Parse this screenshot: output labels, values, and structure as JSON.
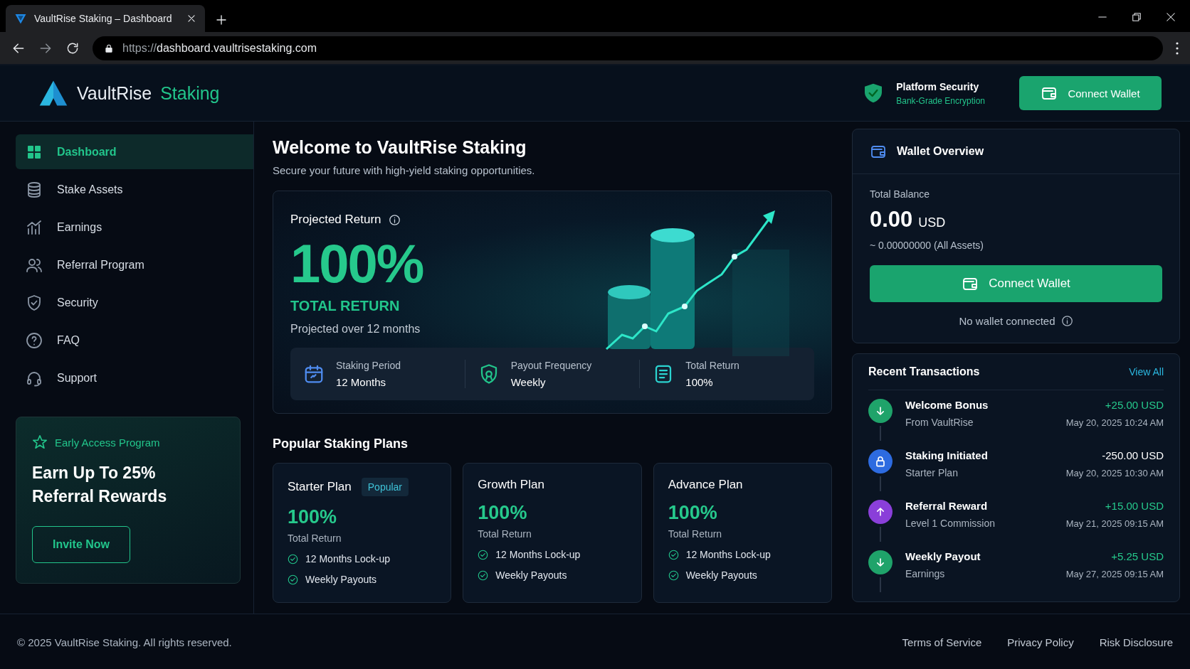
{
  "browser": {
    "tab_title": "VaultRise Staking – Dashboard",
    "url_scheme": "https://",
    "url_host": "dashboard.vaultrisestaking.com"
  },
  "header": {
    "brand": "VaultRise",
    "brand_accent": "Staking",
    "security_title": "Platform Security",
    "security_subtitle": "Bank-Grade Encryption",
    "connect_button": "Connect Wallet"
  },
  "sidebar": {
    "items": [
      {
        "label": "Dashboard",
        "kind": "grid",
        "selected": true
      },
      {
        "label": "Stake Assets",
        "kind": "coins",
        "selected": false
      },
      {
        "label": "Earnings",
        "kind": "chart",
        "selected": false
      },
      {
        "label": "Referral Program",
        "kind": "people",
        "selected": false
      },
      {
        "label": "Security",
        "kind": "shield",
        "selected": false
      },
      {
        "label": "FAQ",
        "kind": "question",
        "selected": false
      },
      {
        "label": "Support",
        "kind": "headset",
        "selected": false
      }
    ],
    "promo": {
      "label": "Early Access Program",
      "title": "Earn Up To 25% Referral Rewards",
      "button": "Invite Now"
    }
  },
  "main": {
    "title": "Welcome to VaultRise Staking",
    "subtitle": "Secure your future with high-yield staking opportunities.",
    "hero": {
      "label": "Projected Return",
      "value": "100%",
      "value_label": "TOTAL RETURN",
      "note": "Projected over 12 months",
      "stats": [
        {
          "kind": "calendar",
          "label": "Staking Period",
          "value": "12 Months"
        },
        {
          "kind": "badge",
          "label": "Payout Frequency",
          "value": "Weekly"
        },
        {
          "kind": "document",
          "label": "Total Return",
          "value": "100%"
        }
      ]
    },
    "plans_title": "Popular Staking Plans",
    "plans": [
      {
        "name": "Starter Plan",
        "badge": "Popular",
        "value": "100%",
        "value_label": "Total Return",
        "features": [
          "12 Months Lock-up",
          "Weekly Payouts"
        ]
      },
      {
        "name": "Growth Plan",
        "value": "100%",
        "value_label": "Total Return",
        "features": [
          "12 Months Lock-up",
          "Weekly Payouts"
        ]
      },
      {
        "name": "Advance Plan",
        "value": "100%",
        "value_label": "Total Return",
        "features": [
          "12 Months Lock-up",
          "Weekly Payouts"
        ]
      }
    ]
  },
  "wallet": {
    "title": "Wallet Overview",
    "balance_label": "Total Balance",
    "balance": "0.00",
    "currency": "USD",
    "approx": "~ 0.00000000 (All Assets)",
    "button": "Connect Wallet",
    "status": "No wallet connected"
  },
  "transactions": {
    "title": "Recent Transactions",
    "view_all": "View All",
    "items": [
      {
        "title": "Welcome Bonus",
        "subtitle": "From VaultRise",
        "amount": "+25.00 USD",
        "credit": true,
        "date": "May 20, 2025 10:24 AM",
        "kind": "down",
        "color": "#1fa36a"
      },
      {
        "title": "Staking Initiated",
        "subtitle": "Starter Plan",
        "amount": "-250.00 USD",
        "credit": false,
        "date": "May 20, 2025 10:30 AM",
        "kind": "lock",
        "color": "#2d6be0"
      },
      {
        "title": "Referral Reward",
        "subtitle": "Level 1 Commission",
        "amount": "+15.00 USD",
        "credit": true,
        "date": "May 21, 2025 09:15 AM",
        "kind": "up",
        "color": "#8a3fd9"
      },
      {
        "title": "Weekly Payout",
        "subtitle": "Earnings",
        "amount": "+5.25 USD",
        "credit": true,
        "date": "May 27, 2025 09:15 AM",
        "kind": "down",
        "color": "#1fa36a"
      }
    ]
  },
  "footer": {
    "copyright": "© 2025 VaultRise Staking. All rights reserved.",
    "links": [
      "Terms of Service",
      "Privacy Policy",
      "Risk Disclosure"
    ]
  }
}
